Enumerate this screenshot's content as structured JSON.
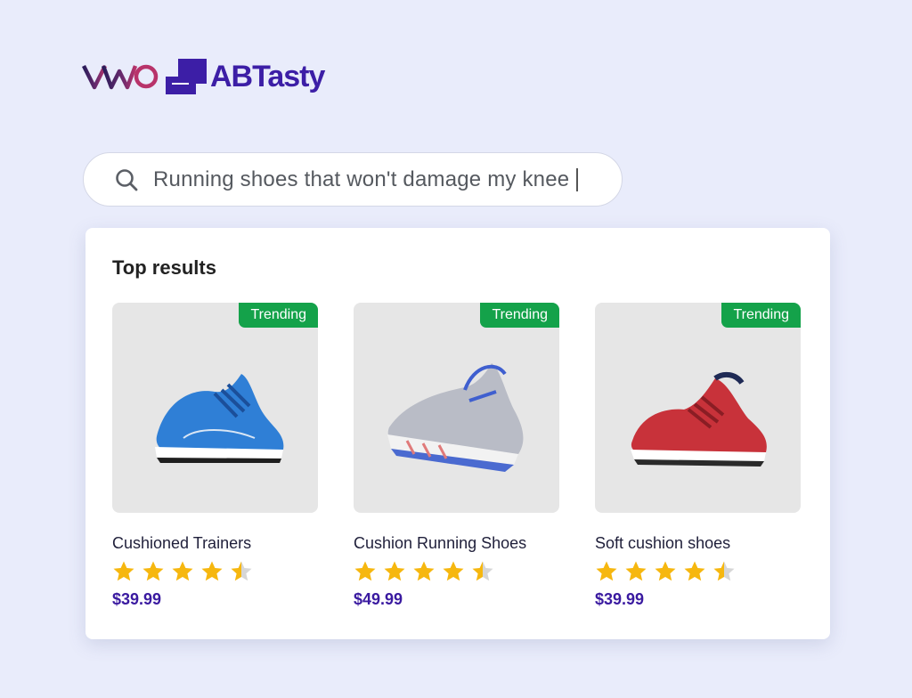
{
  "brand": {
    "logo_left": "VWO",
    "logo_right": "ABTasty"
  },
  "search": {
    "query": "Running shoes that won't damage my knee",
    "icon": "search-icon"
  },
  "results": {
    "title": "Top results",
    "items": [
      {
        "badge": "Trending",
        "name": "Cushioned Trainers",
        "rating": 4.5,
        "price": "$39.99",
        "shoe_color": "#2f7fd6",
        "image": "blue running shoe"
      },
      {
        "badge": "Trending",
        "name": "Cushion Running Shoes",
        "rating": 4.5,
        "price": "$49.99",
        "shoe_color": "#b9bcc6",
        "image": "grey running shoe"
      },
      {
        "badge": "Trending",
        "name": "Soft cushion shoes",
        "rating": 4.5,
        "price": "$39.99",
        "shoe_color": "#c8323a",
        "image": "red running shoe"
      }
    ]
  },
  "colors": {
    "background": "#e9ecfb",
    "badge": "#14a24a",
    "price": "#3a1aa0",
    "star": "#f6b70f"
  }
}
